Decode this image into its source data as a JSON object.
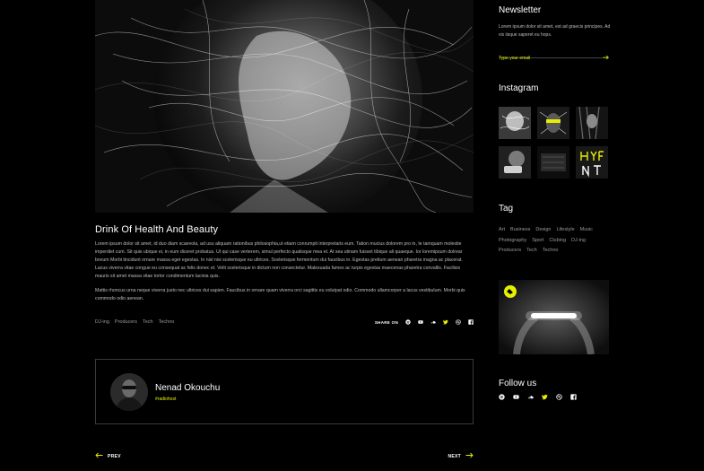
{
  "post": {
    "title": "Drink Of Health And Beauty",
    "paragraph1": "Lorem ipsum dolor sit amet, id duo diam scaevola, ad usu aliquam rationibus philosophia,ut etiam conrumpit interpretaris eum. Tation mucius dolorem pro in, te tamquam molestie imperdiet cum. Sit quis ubique ei, in eum diceret probatus. Ut qui case verterem, simul perfecto qualisque mea et. At sea utinam fuisset tibique ali quaeque. Ior loremipsum dolrear bovum Morbi tincidunt ornare massa eget egestas. In nisl nisi scelerisque eu ultrices. Scelerisque fermentum dui faucibus in. Egestas pretium aenean pharetra magna ac placerat. Lacus viverra vitae congue eu consequat ac felis donec et. Velit scelerisque in dictum non consectetur. Malesuada fames ac turpis egestas maecenas pharetra convallis. Facilisis mauris sit amet massa vitae tortor condimentum lacinia quis.",
    "paragraph2": "Mattis rhoncus urna neque viverra justo nec ultrices dui sapien. Faucibus in ornare quam viverra orci sagittis eu volutpat odio. Commodo ullamcorper a lacus vestibulum. Morbi quis commodo odio aenean.",
    "tags": [
      "DJ-ing",
      "Producers",
      "Tech",
      "Techno"
    ],
    "share_label": "SHARE ON",
    "share_icons": [
      "spotify-icon",
      "youtube-icon",
      "soundcloud-icon",
      "twitter-icon",
      "dribbble-icon",
      "facebook-icon"
    ]
  },
  "author": {
    "name": "Nenad Okouchu",
    "tag": "#radiohost"
  },
  "nav": {
    "prev_label": "PREV",
    "next_label": "NEXT"
  },
  "sidebar": {
    "newsletter": {
      "title": "Newsletter",
      "text": "Lorem ipsum dolor sit amet, est ad graecis principes. Ad vis iisque saperet eu hops.",
      "placeholder": "Type your email"
    },
    "instagram": {
      "title": "Instagram"
    },
    "tag_title": "Tag",
    "tags": [
      "Art",
      "Business",
      "Design",
      "Lifestyle",
      "Music",
      "Photography",
      "Sport",
      "Clubing",
      "DJ-ing",
      "Producers",
      "Tech",
      "Techno"
    ],
    "follow": {
      "title": "Follow us",
      "icons": [
        "spotify-icon",
        "youtube-icon",
        "soundcloud-icon",
        "twitter-icon",
        "dribbble-icon",
        "facebook-icon"
      ]
    }
  },
  "colors": {
    "background": "#000000",
    "accent": "#e6f000",
    "text_muted": "#9a9a9a",
    "border": "#3a3a3a"
  }
}
